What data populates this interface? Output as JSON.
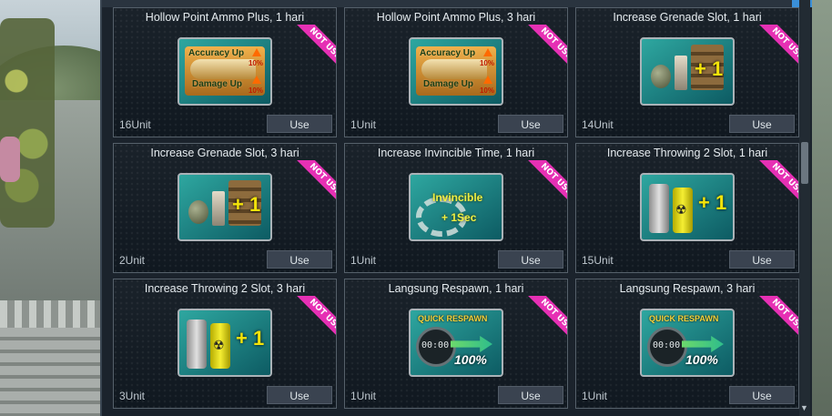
{
  "use_label": "Use",
  "badge_label": "NOT USE",
  "items": [
    {
      "title": "Hollow Point Ammo Plus, 1 hari",
      "unit": "16Unit",
      "icon": "ammo-icon"
    },
    {
      "title": "Hollow Point Ammo Plus, 3 hari",
      "unit": "1Unit",
      "icon": "ammo-icon"
    },
    {
      "title": "Increase Grenade Slot, 1 hari",
      "unit": "14Unit",
      "icon": "grenade-slot-icon"
    },
    {
      "title": "Increase Grenade Slot, 3 hari",
      "unit": "2Unit",
      "icon": "grenade-slot-icon"
    },
    {
      "title": "Increase Invincible Time, 1 hari",
      "unit": "1Unit",
      "icon": "invincible-icon"
    },
    {
      "title": "Increase Throwing 2 Slot, 1 hari",
      "unit": "15Unit",
      "icon": "throwing-slot-icon"
    },
    {
      "title": "Increase Throwing 2 Slot, 3 hari",
      "unit": "3Unit",
      "icon": "throwing-slot-icon"
    },
    {
      "title": "Langsung Respawn, 1 hari",
      "unit": "1Unit",
      "icon": "quick-respawn-icon"
    },
    {
      "title": "Langsung Respawn, 3 hari",
      "unit": "1Unit",
      "icon": "quick-respawn-icon"
    }
  ],
  "icon_text": {
    "accuracy": "Accuracy Up",
    "damage": "Damage Up",
    "percent": "10%",
    "plus_one": "+ 1",
    "invincible": "Invincible",
    "plus_sec": "+ 1Sec",
    "quick_respawn": "QUICK RESPAWN",
    "clock": "00:00",
    "hundred": "100%"
  },
  "colors": {
    "accent": "#3a8fd8",
    "badge": "#e630b4",
    "panel": "#1b232c"
  }
}
